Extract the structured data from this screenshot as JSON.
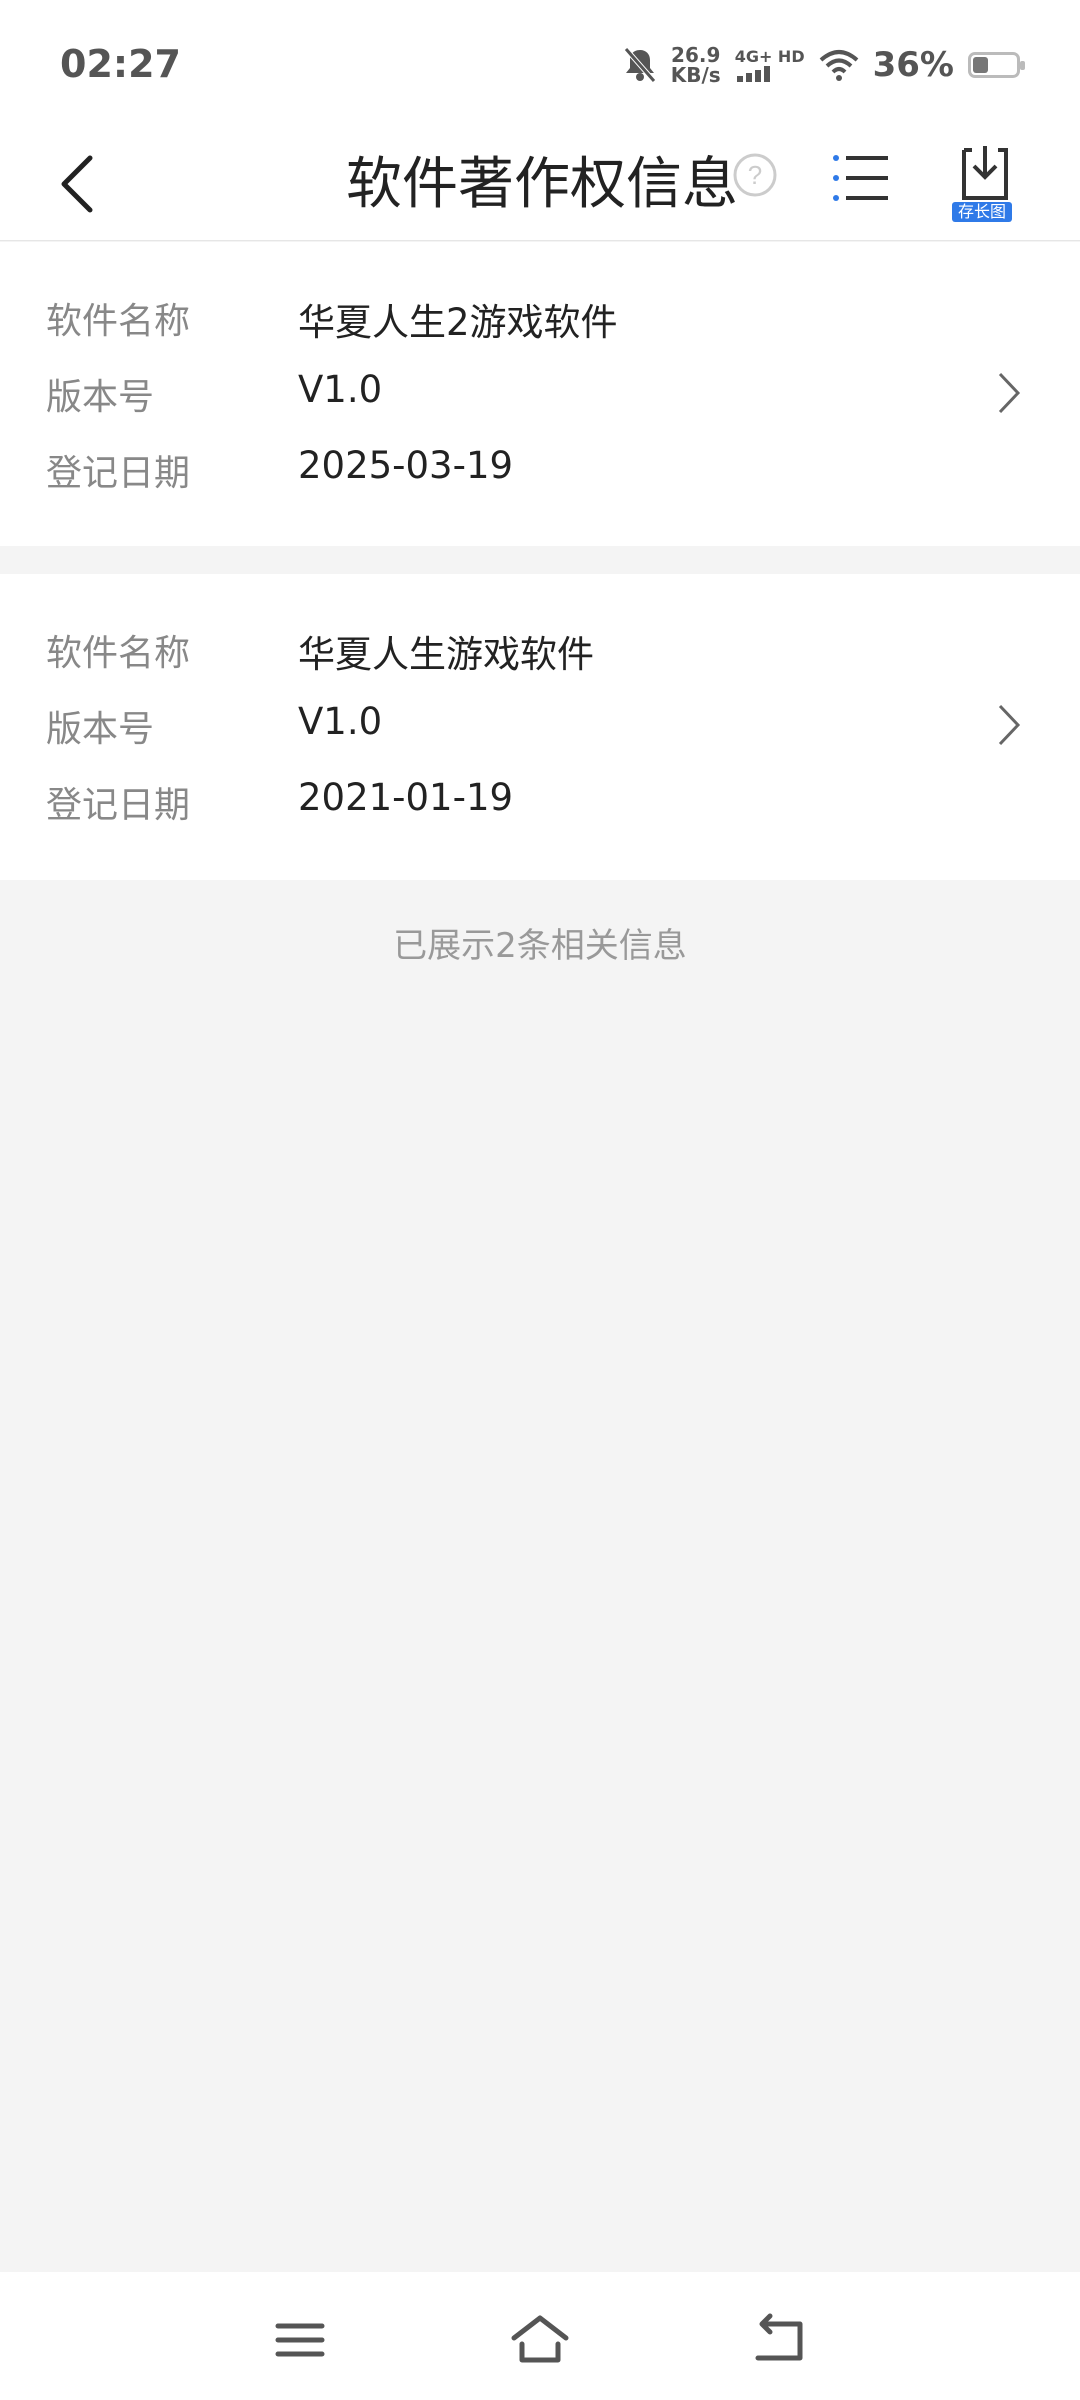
{
  "status_bar": {
    "time": "02:27",
    "speed_value": "26.9",
    "speed_unit": "KB/s",
    "network_type": "4G+ HD",
    "battery_percent": "36%",
    "battery_level": 0.36
  },
  "header": {
    "title": "软件著作权信息",
    "save_badge": "存长图"
  },
  "records": [
    {
      "name_label": "软件名称",
      "name": "华夏人生2游戏软件",
      "version_label": "版本号",
      "version": "V1.0",
      "date_label": "登记日期",
      "date": "2025-03-19"
    },
    {
      "name_label": "软件名称",
      "name": "华夏人生游戏软件",
      "version_label": "版本号",
      "version": "V1.0",
      "date_label": "登记日期",
      "date": "2021-01-19"
    }
  ],
  "footer_note": "已展示2条相关信息",
  "colors": {
    "accent": "#2f7ae8",
    "label": "#888888",
    "value": "#222222"
  }
}
